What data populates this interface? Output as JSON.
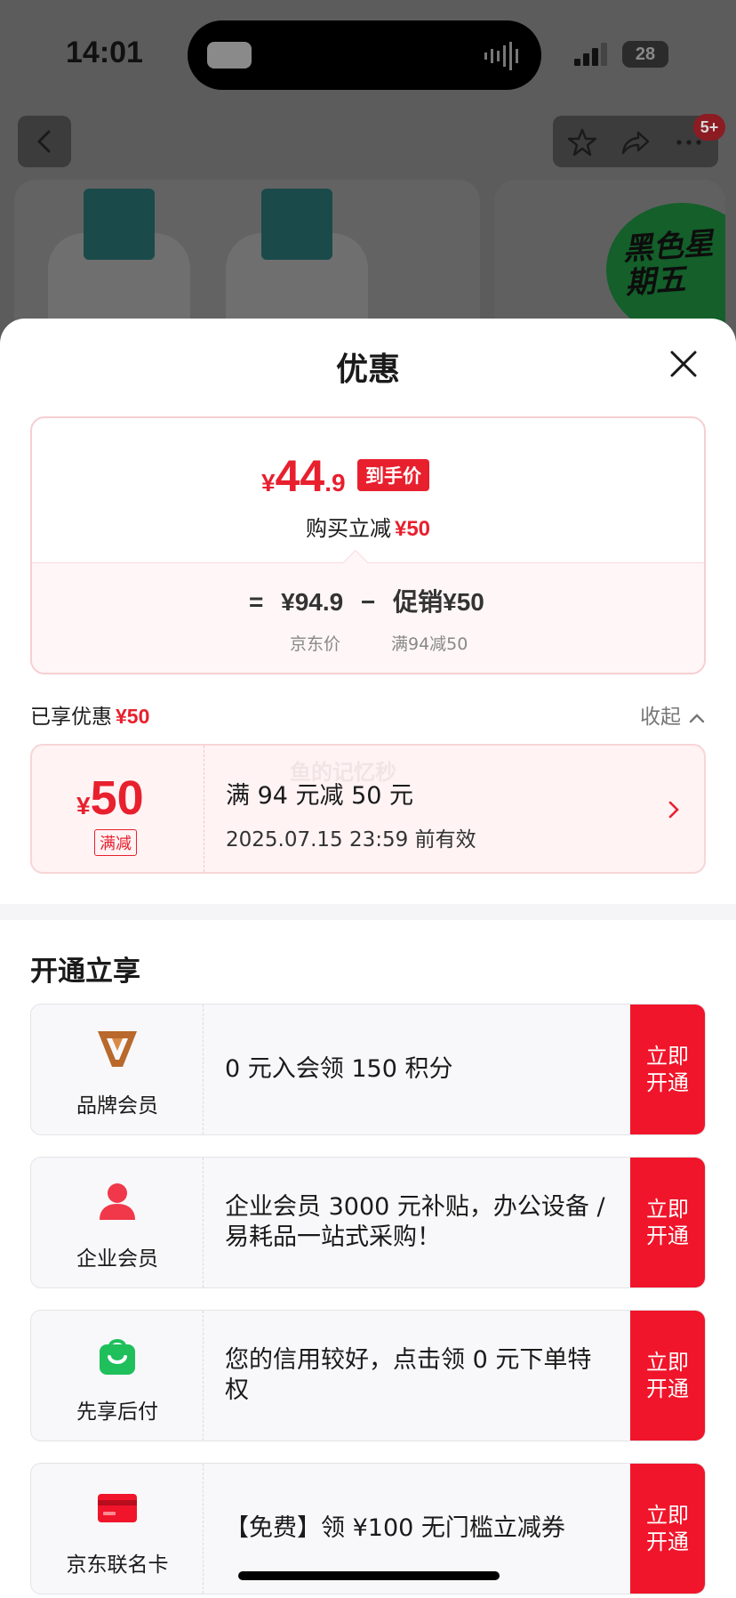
{
  "status_bar": {
    "time": "14:01",
    "battery": "28"
  },
  "nav": {
    "badge": "5+"
  },
  "background": {
    "promo_badge": "黑色星期五"
  },
  "sheet": {
    "title": "优惠",
    "price_card": {
      "currency": "¥",
      "final_int": "44",
      "final_dec": ".9",
      "final_tag": "到手价",
      "reduce_label": "购买立减",
      "reduce_amount": "¥50",
      "formula": {
        "eq": "=",
        "jd_price": "¥94.9",
        "minus": "−",
        "promo": "促销¥50",
        "jd_price_label": "京东价",
        "promo_label": "满94减50"
      }
    },
    "enjoyed": {
      "label": "已享优惠",
      "amount": "¥50",
      "collapse_label": "收起"
    },
    "coupon": {
      "currency": "¥",
      "amount": "50",
      "tag": "满减",
      "title": "满 94 元减 50 元",
      "valid": "2025.07.15 23:59 前有效"
    },
    "watermark": "鱼的记忆秒",
    "benefits_title": "开通立享",
    "benefits": [
      {
        "name": "品牌会员",
        "desc": "0 元入会领 150 积分",
        "button": "立即开通",
        "icon": "brand-v-icon"
      },
      {
        "name": "企业会员",
        "desc": " 企业会员 3000 元补贴，办公设备 / 易耗品一站式采购！",
        "button": "立即开通",
        "icon": "person-icon"
      },
      {
        "name": "先享后付",
        "desc": "您的信用较好，点击领 0 元下单特权",
        "button": "立即开通",
        "icon": "shopping-bag-icon"
      },
      {
        "name": "京东联名卡",
        "desc": "【免费】领 ¥100 无门槛立减券",
        "button": "立即开通",
        "icon": "credit-card-icon"
      }
    ]
  },
  "colors": {
    "accent": "#e8202e",
    "button_red": "#f0152a",
    "brand_v": "#b8692b",
    "green": "#1fbf5c"
  }
}
